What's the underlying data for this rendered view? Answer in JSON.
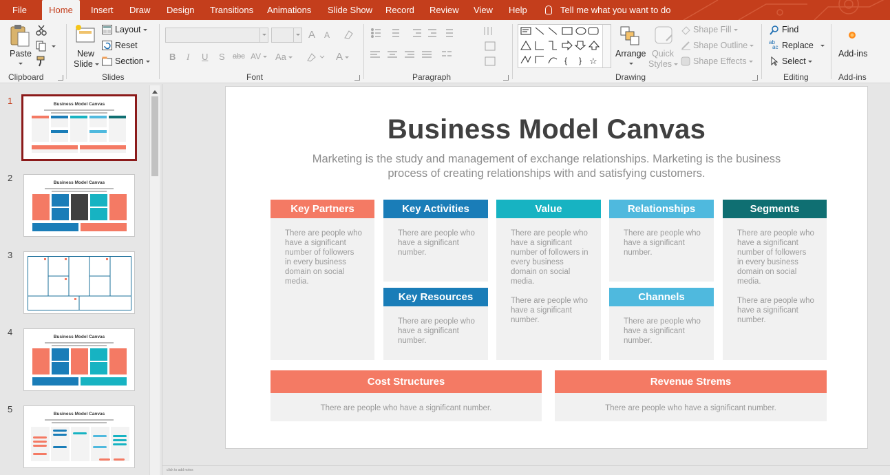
{
  "tabs": [
    "File",
    "Home",
    "Insert",
    "Draw",
    "Design",
    "Transitions",
    "Animations",
    "Slide Show",
    "Record",
    "Review",
    "View",
    "Help"
  ],
  "active_tab": "Home",
  "tell_me": "Tell me what you want to do",
  "ribbon": {
    "clipboard": {
      "label": "Clipboard",
      "paste": "Paste"
    },
    "slides": {
      "label": "Slides",
      "new_slide_line1": "New",
      "new_slide_line2": "Slide",
      "layout": "Layout",
      "reset": "Reset",
      "section": "Section"
    },
    "font": {
      "label": "Font",
      "grow": "A",
      "shrink": "A",
      "bold": "B",
      "italic": "I",
      "underline": "U",
      "strike": "S",
      "abc": "abc",
      "spacing": "AV",
      "case": "Aa",
      "color": "A"
    },
    "paragraph": {
      "label": "Paragraph"
    },
    "drawing": {
      "label": "Drawing",
      "arrange": "Arrange",
      "quick_styles_line1": "Quick",
      "quick_styles_line2": "Styles",
      "shape_fill": "Shape Fill",
      "shape_outline": "Shape Outline",
      "shape_effects": "Shape Effects",
      "shape_glyphs": [
        "{",
        "}",
        "☆"
      ]
    },
    "editing": {
      "label": "Editing",
      "find": "Find",
      "replace": "Replace",
      "replace_icon_top": "ab",
      "replace_icon_bottom": "ac",
      "select": "Select"
    },
    "addins": {
      "label": "Add-ins",
      "addins": "Add-ins"
    }
  },
  "thumbnails": [
    {
      "number": "1",
      "title": "Business Model Canvas",
      "selected": true
    },
    {
      "number": "2",
      "title": "Business Model Canvas",
      "selected": false
    },
    {
      "number": "3",
      "title": "",
      "selected": false
    },
    {
      "number": "4",
      "title": "Business Model Canvas",
      "selected": false
    },
    {
      "number": "5",
      "title": "Business Model Canvas",
      "selected": false
    }
  ],
  "slide": {
    "title": "Business Model Canvas",
    "subtitle": "Marketing is the study and management of exchange relationships. Marketing is the business process of creating relationships with and satisfying customers.",
    "cards": {
      "key_partners": {
        "title": "Key Partners",
        "color": "#f47a64",
        "body": [
          "There are people who have a significant number of followers in every business domain on social media."
        ]
      },
      "key_activities": {
        "title": "Key Activities",
        "color": "#1a7db8",
        "body": [
          "There are people who have a significant number."
        ]
      },
      "key_resources": {
        "title": "Key Resources",
        "color": "#1a7db8",
        "body": [
          "There are people who have a significant number."
        ]
      },
      "value": {
        "title": "Value",
        "color": "#17b3c2",
        "body": [
          "There are people who have a significant number of followers in every business domain on social media.",
          "There are people who have a significant number."
        ]
      },
      "relationships": {
        "title": "Relationships",
        "color": "#4fb9de",
        "body": [
          "There are people who have a significant number."
        ]
      },
      "channels": {
        "title": "Channels",
        "color": "#4fb9de",
        "body": [
          "There are people who have a significant number."
        ]
      },
      "segments": {
        "title": "Segments",
        "color": "#0f6f72",
        "body": [
          "There are people who have a significant number of followers in every business domain on social media.",
          "There are people who have a significant number."
        ]
      },
      "cost_structures": {
        "title": "Cost Structures",
        "color": "#f47a64",
        "body": [
          "There are people who have a significant number."
        ]
      },
      "revenue_streams": {
        "title": "Revenue Strems",
        "color": "#f47a64",
        "body": [
          "There are people who have a significant number."
        ]
      }
    }
  },
  "status_bar": "click to add notes",
  "colors": {
    "accent": "#c43e1c",
    "ribbon_bg": "#f3f3f3",
    "slide_bg": "#ffffff"
  }
}
